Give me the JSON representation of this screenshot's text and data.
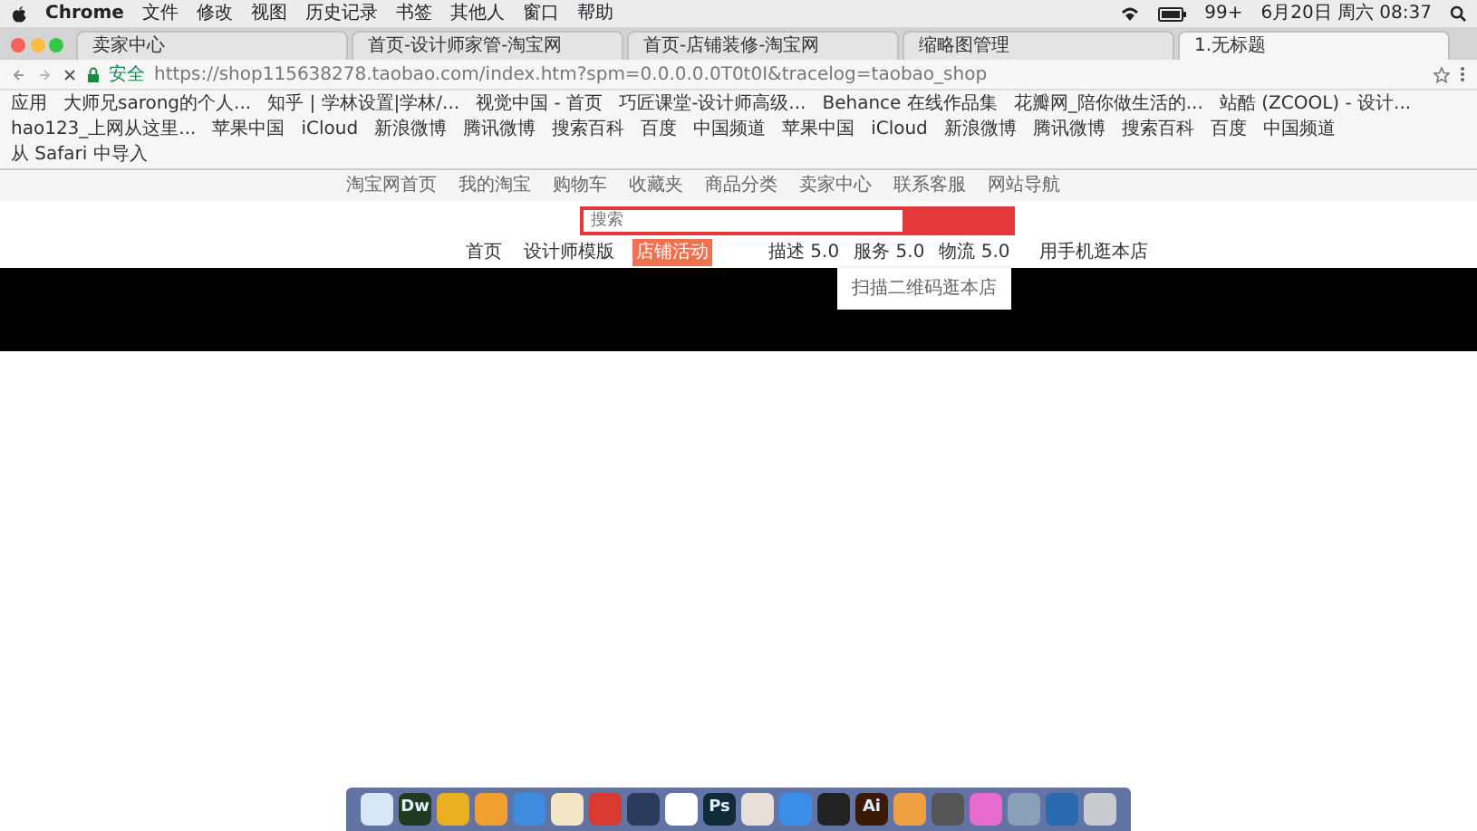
{
  "menu_bar": {
    "app": "Chrome",
    "items": [
      "文件",
      "修改",
      "视图",
      "历史记录",
      "书签",
      "其他人",
      "窗口",
      "帮助"
    ],
    "battery": "99+",
    "clock": "6月20日 周六 08:37"
  },
  "tabs": [
    {
      "label": "卖家中心",
      "selected": false
    },
    {
      "label": "首页-设计师家管-淘宝网",
      "selected": false
    },
    {
      "label": "首页-店铺装修-淘宝网",
      "selected": false
    },
    {
      "label": "缩略图管理",
      "selected": false
    },
    {
      "label": "1.无标题",
      "selected": true
    }
  ],
  "address_bar": {
    "security": "安全",
    "url": "https://shop115638278.taobao.com/index.htm?spm=0.0.0.0.0T0t0I&tracelog=taobao_shop"
  },
  "bookmarks": [
    "应用",
    "大师兄sarong的个人...",
    "知乎 | 学林设置|学林/...",
    "视觉中国 - 首页",
    "巧匠课堂-设计师高级...",
    "Behance 在线作品集",
    "花瓣网_陪你做生活的...",
    "站酷 (ZCOOL) - 设计...",
    "hao123_上网从这里...",
    "苹果中国",
    "iCloud",
    "新浪微博",
    "腾讯微博",
    "搜索百科",
    "百度",
    "中国频道",
    "苹果中国",
    "iCloud",
    "新浪微博",
    "腾讯微博",
    "搜索百科",
    "百度",
    "中国频道",
    "从 Safari 中导入"
  ],
  "site_nav": [
    "淘宝网首页",
    "我的淘宝",
    "购物车",
    "收藏夹",
    "商品分类",
    "卖家中心",
    "联系客服",
    "网站导航"
  ],
  "search": {
    "placeholder": "搜索"
  },
  "store_nav": [
    {
      "label": "首页",
      "selected": false
    },
    {
      "label": "设计师模版",
      "selected": false
    },
    {
      "label": "店铺活动",
      "selected": true
    }
  ],
  "ratings": [
    "描述 5.0",
    "服务 5.0",
    "物流 5.0"
  ],
  "mobile_link": "用手机逛本店",
  "qr_popup": "扫描二维码逛本店",
  "dock": [
    {
      "color": "#d9e6f5"
    },
    {
      "label": "Dw",
      "color": "#1f3a1f"
    },
    {
      "color": "#e8b020"
    },
    {
      "color": "#f0a030"
    },
    {
      "color": "#3d8ce0"
    },
    {
      "color": "#f2e6c4"
    },
    {
      "color": "#d93a30"
    },
    {
      "color": "#2a3a5a"
    },
    {
      "color": "#ffffff"
    },
    {
      "label": "Ps",
      "color": "#0f2a38"
    },
    {
      "color": "#e8e0d8"
    },
    {
      "color": "#3a8ee8"
    },
    {
      "color": "#222222"
    },
    {
      "label": "Ai",
      "color": "#3a1a05"
    },
    {
      "color": "#f0a040"
    },
    {
      "color": "#555555"
    },
    {
      "color": "#e86ad0"
    },
    {
      "color": "#8aa0b8"
    },
    {
      "color": "#2a6ab0"
    },
    {
      "color": "#c8ccd0"
    }
  ]
}
